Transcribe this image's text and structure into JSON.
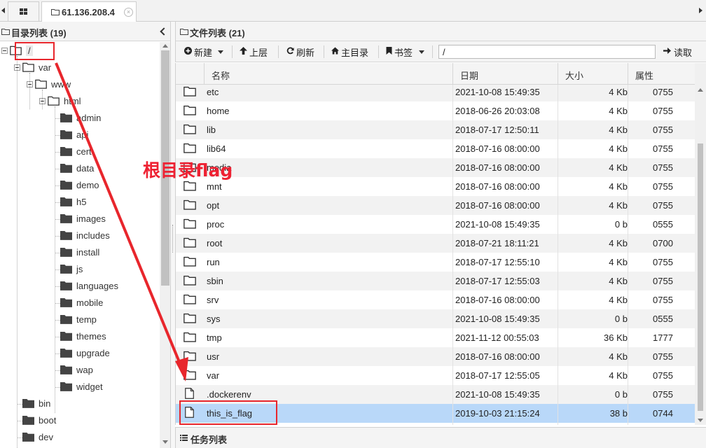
{
  "tabs": {
    "home_icon": "grid-icon",
    "active_label": "61.136.208.4",
    "close_glyph": "⊗"
  },
  "left_panel": {
    "title": "目录列表 (19)",
    "tree": [
      {
        "label": "/",
        "level": 0,
        "type": "folder",
        "expanded": true
      },
      {
        "label": "var",
        "level": 1,
        "type": "folder",
        "expanded": true
      },
      {
        "label": "www",
        "level": 2,
        "type": "folder",
        "expanded": true
      },
      {
        "label": "html",
        "level": 3,
        "type": "folder",
        "expanded": true
      },
      {
        "label": "admin",
        "level": 4,
        "type": "folder-filled"
      },
      {
        "label": "api",
        "level": 4,
        "type": "folder-filled"
      },
      {
        "label": "cert",
        "level": 4,
        "type": "folder-filled"
      },
      {
        "label": "data",
        "level": 4,
        "type": "folder-filled"
      },
      {
        "label": "demo",
        "level": 4,
        "type": "folder-filled"
      },
      {
        "label": "h5",
        "level": 4,
        "type": "folder-filled"
      },
      {
        "label": "images",
        "level": 4,
        "type": "folder-filled"
      },
      {
        "label": "includes",
        "level": 4,
        "type": "folder-filled"
      },
      {
        "label": "install",
        "level": 4,
        "type": "folder-filled"
      },
      {
        "label": "js",
        "level": 4,
        "type": "folder-filled"
      },
      {
        "label": "languages",
        "level": 4,
        "type": "folder-filled"
      },
      {
        "label": "mobile",
        "level": 4,
        "type": "folder-filled"
      },
      {
        "label": "temp",
        "level": 4,
        "type": "folder-filled"
      },
      {
        "label": "themes",
        "level": 4,
        "type": "folder-filled"
      },
      {
        "label": "upgrade",
        "level": 4,
        "type": "folder-filled"
      },
      {
        "label": "wap",
        "level": 4,
        "type": "folder-filled"
      },
      {
        "label": "widget",
        "level": 4,
        "type": "folder-filled"
      },
      {
        "label": "bin",
        "level": 1,
        "type": "folder-filled"
      },
      {
        "label": "boot",
        "level": 1,
        "type": "folder-filled"
      },
      {
        "label": "dev",
        "level": 1,
        "type": "folder-filled"
      }
    ]
  },
  "right_panel": {
    "title": "文件列表 (21)",
    "toolbar": {
      "new_label": "新建",
      "up_label": "上层",
      "refresh_label": "刷新",
      "home_label": "主目录",
      "bookmark_label": "书签",
      "path_value": "/",
      "read_label": "读取"
    },
    "columns": {
      "name": "名称",
      "date": "日期",
      "size": "大小",
      "perm": "属性"
    },
    "files": [
      {
        "name": "etc",
        "date": "2021-10-08 15:49:35",
        "size": "4 Kb",
        "perm": "0755",
        "type": "folder"
      },
      {
        "name": "home",
        "date": "2018-06-26 20:03:08",
        "size": "4 Kb",
        "perm": "0755",
        "type": "folder"
      },
      {
        "name": "lib",
        "date": "2018-07-17 12:50:11",
        "size": "4 Kb",
        "perm": "0755",
        "type": "folder"
      },
      {
        "name": "lib64",
        "date": "2018-07-16 08:00:00",
        "size": "4 Kb",
        "perm": "0755",
        "type": "folder"
      },
      {
        "name": "media",
        "date": "2018-07-16 08:00:00",
        "size": "4 Kb",
        "perm": "0755",
        "type": "folder"
      },
      {
        "name": "mnt",
        "date": "2018-07-16 08:00:00",
        "size": "4 Kb",
        "perm": "0755",
        "type": "folder"
      },
      {
        "name": "opt",
        "date": "2018-07-16 08:00:00",
        "size": "4 Kb",
        "perm": "0755",
        "type": "folder"
      },
      {
        "name": "proc",
        "date": "2021-10-08 15:49:35",
        "size": "0 b",
        "perm": "0555",
        "type": "folder"
      },
      {
        "name": "root",
        "date": "2018-07-21 18:11:21",
        "size": "4 Kb",
        "perm": "0700",
        "type": "folder"
      },
      {
        "name": "run",
        "date": "2018-07-17 12:55:10",
        "size": "4 Kb",
        "perm": "0755",
        "type": "folder"
      },
      {
        "name": "sbin",
        "date": "2018-07-17 12:55:03",
        "size": "4 Kb",
        "perm": "0755",
        "type": "folder"
      },
      {
        "name": "srv",
        "date": "2018-07-16 08:00:00",
        "size": "4 Kb",
        "perm": "0755",
        "type": "folder"
      },
      {
        "name": "sys",
        "date": "2021-10-08 15:49:35",
        "size": "0 b",
        "perm": "0555",
        "type": "folder"
      },
      {
        "name": "tmp",
        "date": "2021-11-12 00:55:03",
        "size": "36 Kb",
        "perm": "1777",
        "type": "folder"
      },
      {
        "name": "usr",
        "date": "2018-07-16 08:00:00",
        "size": "4 Kb",
        "perm": "0755",
        "type": "folder"
      },
      {
        "name": "var",
        "date": "2018-07-17 12:55:05",
        "size": "4 Kb",
        "perm": "0755",
        "type": "folder"
      },
      {
        "name": ".dockerenv",
        "date": "2021-10-08 15:49:35",
        "size": "0 b",
        "perm": "0755",
        "type": "file"
      },
      {
        "name": "this_is_flag",
        "date": "2019-10-03 21:15:24",
        "size": "38 b",
        "perm": "0744",
        "type": "file",
        "selected": true
      }
    ],
    "task_title": "任务列表"
  },
  "annotation": {
    "text": "根目录flag",
    "color": "#ee2233"
  },
  "colors": {
    "selection": "#b9d8f9",
    "alt_row": "#f2f2f2",
    "header_bg": "#f4f4f4"
  }
}
